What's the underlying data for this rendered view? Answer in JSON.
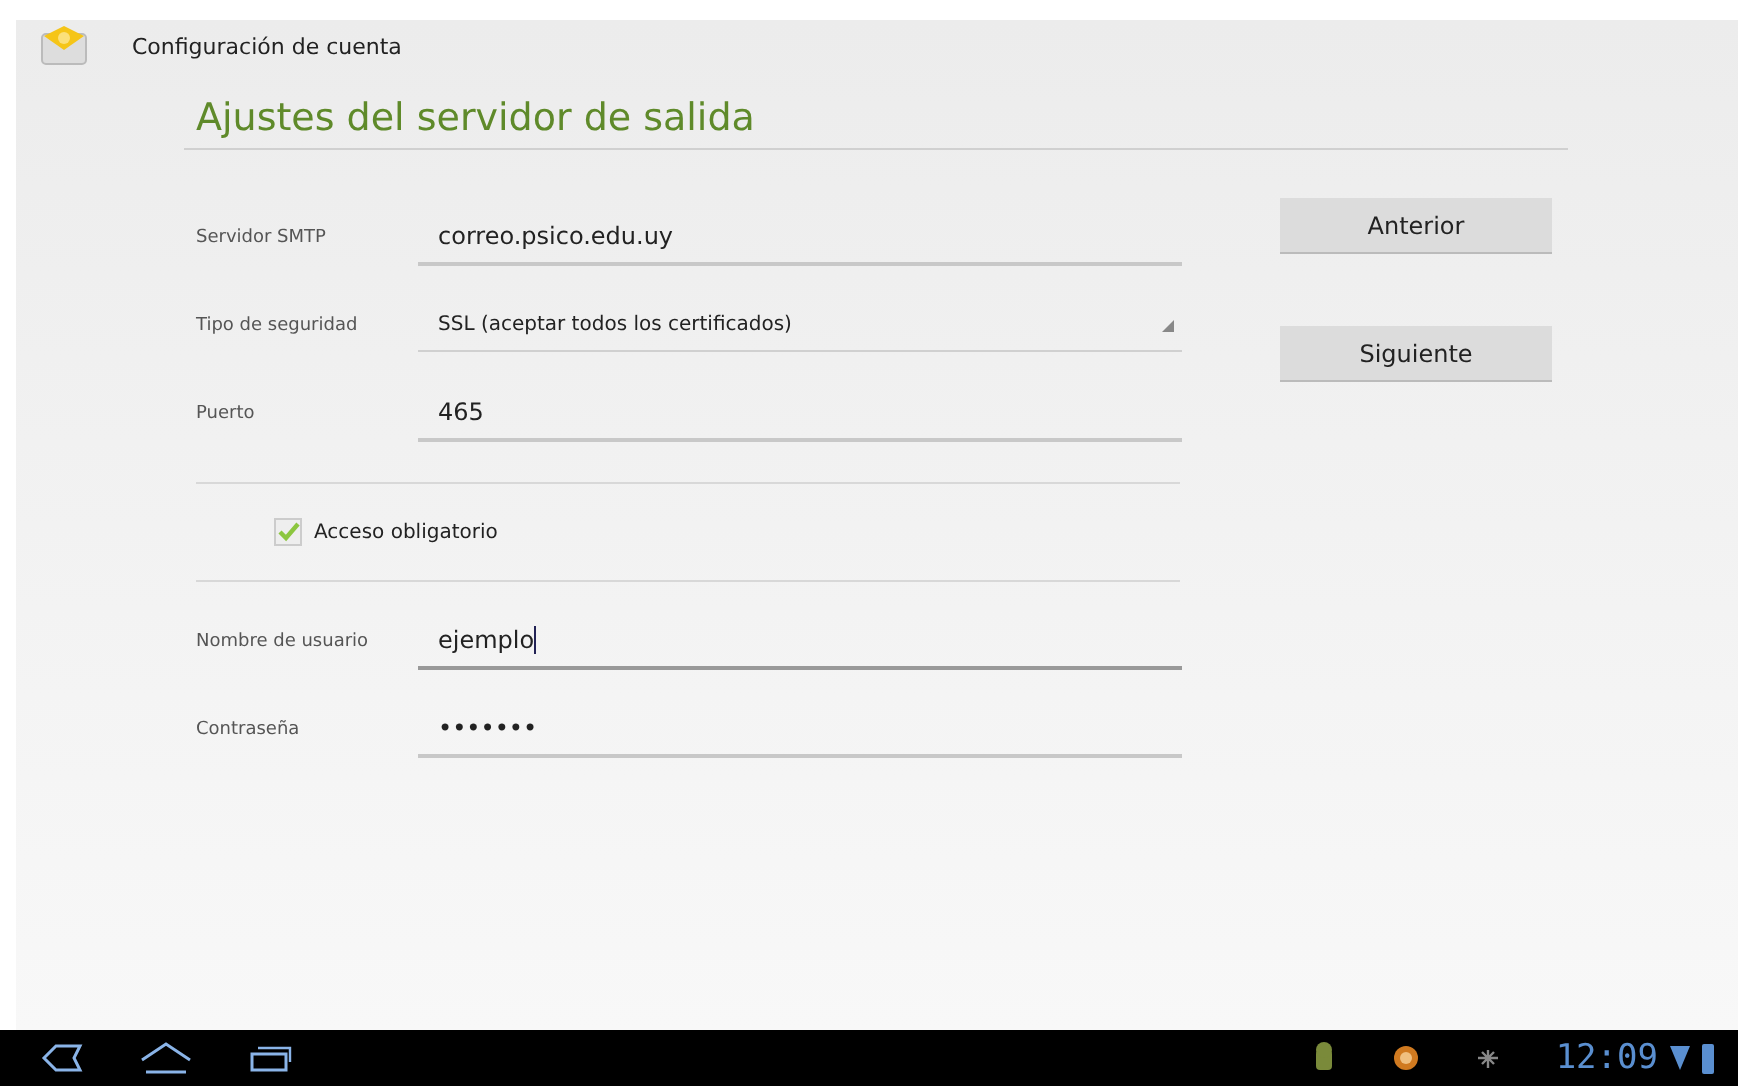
{
  "action_bar": {
    "title": "Configuración de cuenta"
  },
  "heading": "Ajustes del servidor de salida",
  "fields": [
    {
      "kind": "text",
      "label": "Servidor SMTP",
      "value": "correo.psico.edu.uy"
    },
    {
      "kind": "dropdown",
      "label": "Tipo de seguridad",
      "value": "SSL (aceptar todos los certificados)"
    },
    {
      "kind": "text",
      "label": "Puerto",
      "value": "465"
    }
  ],
  "login_required": {
    "label": "Acceso obligatorio",
    "checked": true
  },
  "credentials": [
    {
      "kind": "text",
      "label": "Nombre de usuario",
      "value": "ejemplo"
    },
    {
      "kind": "password",
      "label": "Contraseña",
      "value": "•••••••"
    }
  ],
  "buttons": [
    "Anterior",
    "Siguiente"
  ],
  "status_bar": {
    "time": "12:09"
  }
}
